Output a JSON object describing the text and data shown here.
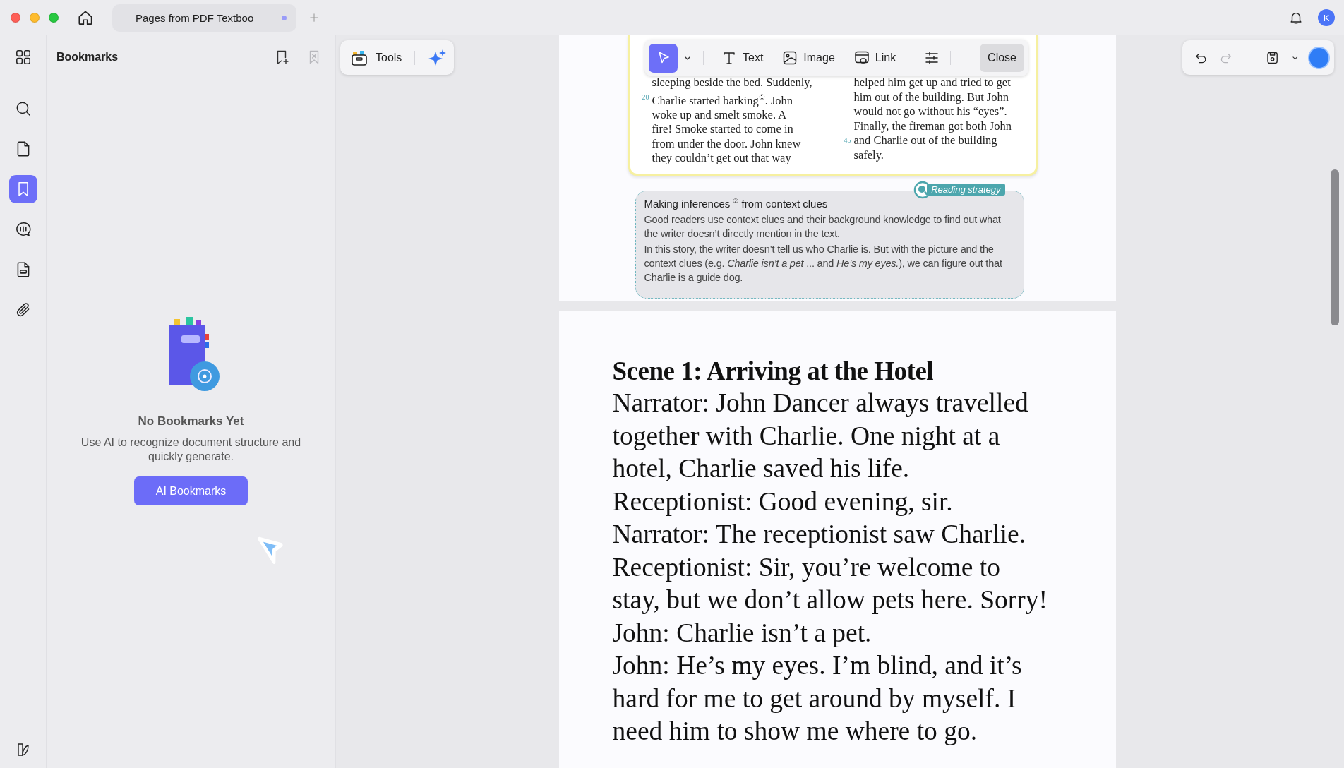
{
  "window": {
    "tab": {
      "title": "Pages from PDF Textboo",
      "unsaved": true
    },
    "avatar": "K"
  },
  "rail": {
    "items": [
      {
        "kind": "grid",
        "selected": false
      },
      {
        "kind": "search",
        "selected": false
      },
      {
        "kind": "page",
        "selected": false
      },
      {
        "kind": "bookmark",
        "selected": true
      },
      {
        "kind": "chat",
        "selected": false
      },
      {
        "kind": "form",
        "selected": false
      },
      {
        "kind": "attachment",
        "selected": false
      }
    ]
  },
  "bookmarks": {
    "title": "Bookmarks",
    "actions": [
      {
        "kind": "add",
        "disabled": false
      },
      {
        "kind": "remove",
        "disabled": true
      }
    ],
    "empty_title": "No Bookmarks Yet",
    "empty_text": "Use AI to recognize document structure and quickly generate.",
    "button": "AI Bookmarks"
  },
  "tools": {
    "label": "Tools"
  },
  "edit_toolbar": {
    "select_selected": true,
    "items": [
      {
        "kind": "text",
        "label": "Text"
      },
      {
        "kind": "image",
        "label": "Image"
      },
      {
        "kind": "link",
        "label": "Link"
      }
    ],
    "close": "Close"
  },
  "history": [
    {
      "kind": "undo",
      "disabled": false
    },
    {
      "kind": "redo",
      "disabled": true
    }
  ],
  "page_1": {
    "columns": [
      {
        "lines": [
          {
            "text": "sleeping beside the bed. Suddenly,"
          },
          {
            "number": "20",
            "text": "Charlie started barking$^{①}$. John"
          },
          {
            "text": "woke up and smelt smoke. A"
          },
          {
            "text": "fire! Smoke started to come in"
          },
          {
            "text": "from under the door. John knew"
          },
          {
            "text": "they couldn’t get out that way"
          }
        ]
      },
      {
        "lines": [
          {
            "text": "helped him get up and tried to get"
          },
          {
            "text": "him out of the building. But John"
          },
          {
            "text": "would not go without his “eyes”."
          },
          {
            "text": "Finally, the fireman got both John"
          },
          {
            "number": "45",
            "text": "and Charlie out of the building"
          },
          {
            "text": "safely."
          }
        ]
      }
    ],
    "strategy": {
      "badge": "Reading strategy",
      "title": "Making inferences $^{②}$ from context clues",
      "paragraphs": [
        "Good readers use context clues and their background knowledge to find out what the writer doesn’t directly mention in the text.",
        "In this story, the writer doesn’t tell us who Charlie is. But with the picture and the context clues (e.g. *Charlie isn’t a pet* ... and *He’s my eyes.*), we can figure out that Charlie is a guide dog."
      ]
    }
  },
  "page_2": {
    "heading": "Scene 1: Arriving at the Hotel",
    "lines": [
      "Narrator: John Dancer always travelled",
      "together with Charlie. One night at a",
      "hotel, Charlie saved his life.",
      "Receptionist: Good evening, sir.",
      "Narrator: The receptionist saw Charlie.",
      "Receptionist: Sir, you’re welcome to",
      "stay, but we don’t allow pets here. Sorry!",
      "John: Charlie isn’t a pet.",
      "John: He’s my eyes. I’m blind, and it’s",
      "hard for me to get around by myself. I",
      "need him to show me where to go."
    ]
  }
}
